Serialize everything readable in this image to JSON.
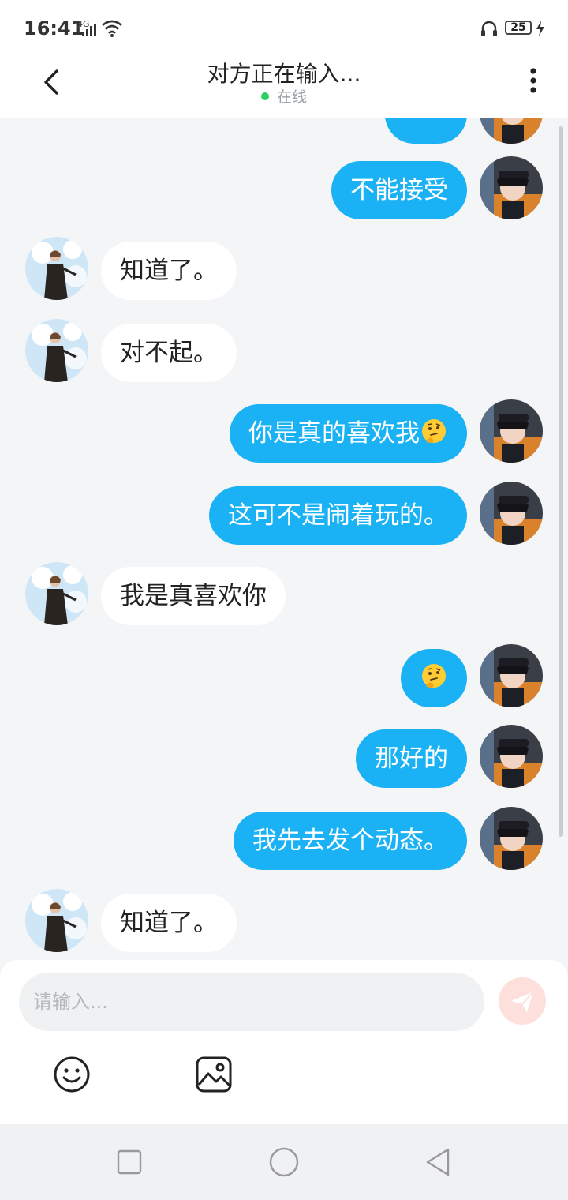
{
  "status_bar": {
    "time": "16:41",
    "network": "4G",
    "battery": "25"
  },
  "header": {
    "title": "对方正在输入...",
    "status": "在线"
  },
  "colors": {
    "my_bubble": "#1ab2f5",
    "other_bubble": "#ffffff",
    "online_dot": "#2bd163",
    "background": "#f3f5f7"
  },
  "messages": [
    {
      "sender": "me",
      "text": ""
    },
    {
      "sender": "me",
      "text": "不能接受"
    },
    {
      "sender": "other",
      "text": "知道了。"
    },
    {
      "sender": "other",
      "text": "对不起。"
    },
    {
      "sender": "me",
      "text": "你是真的喜欢我",
      "emoji": "thinking-face"
    },
    {
      "sender": "me",
      "text": "这可不是闹着玩的。"
    },
    {
      "sender": "other",
      "text": "我是真喜欢你"
    },
    {
      "sender": "me",
      "text": "",
      "emoji": "thinking-face"
    },
    {
      "sender": "me",
      "text": "那好的"
    },
    {
      "sender": "me",
      "text": "我先去发个动态。"
    },
    {
      "sender": "other",
      "text": "知道了。"
    }
  ],
  "composer": {
    "placeholder": "请输入...",
    "tools": [
      "smiley-icon",
      "image-icon"
    ]
  },
  "navigation": [
    "recent-apps-icon",
    "home-icon",
    "back-icon"
  ]
}
